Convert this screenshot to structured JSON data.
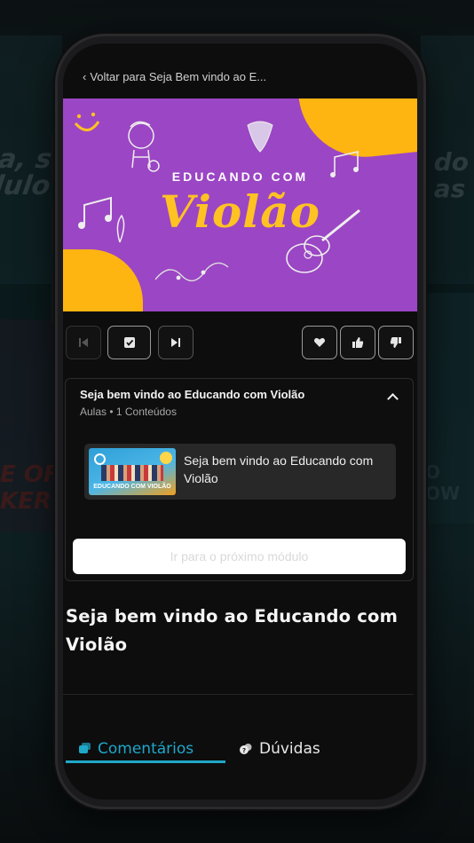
{
  "back_link": {
    "label": "Voltar para Seja Bem vindo ao E..."
  },
  "banner": {
    "line1": "EDUCANDO COM",
    "line2": "Violão"
  },
  "module": {
    "title": "Seja bem vindo ao Educando com Violão",
    "subtitle": "Aulas • 1 Conteúdos",
    "lessons": [
      {
        "title": "Seja bem vindo ao Educando com Violão",
        "thumb_caption": "EDUCANDO COM VIOLÃO"
      }
    ],
    "next_button": "Ir para o próximo módulo"
  },
  "lesson_heading": "Seja bem vindo ao Educando com Violão",
  "tabs": [
    {
      "label": "Comentários",
      "active": true,
      "icon": "comments-icon"
    },
    {
      "label": "Dúvidas",
      "active": false,
      "icon": "questions-icon"
    }
  ],
  "controls": [
    {
      "icon": "skip-previous-icon",
      "enabled": false
    },
    {
      "icon": "check-icon",
      "enabled": true
    },
    {
      "icon": "skip-next-icon",
      "enabled": true
    },
    {
      "icon": "heart-icon",
      "enabled": true
    },
    {
      "icon": "thumbs-up-icon",
      "enabled": true
    },
    {
      "icon": "thumbs-down-icon",
      "enabled": true
    }
  ],
  "colors": {
    "accent": "#1fa7c9",
    "banner_purple": "#9b46c4",
    "banner_yellow": "#ffb511"
  }
}
